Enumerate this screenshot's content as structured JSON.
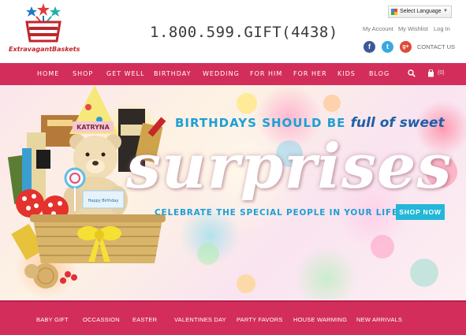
{
  "header": {
    "logo_text": "ExtravagantBaskets",
    "phone": "1.800.599.GIFT(4438)",
    "language_label": "Select Language",
    "links": {
      "account": "My Account",
      "wishlist": "My Wishlist",
      "login": "Log In"
    },
    "social": {
      "facebook": "f",
      "twitter": "t",
      "googleplus": "g+"
    },
    "contact_label": "CONTACT US"
  },
  "nav": {
    "items": [
      "HOME",
      "SHOP",
      "GET WELL",
      "BIRTHDAY",
      "WEDDING",
      "FOR HIM",
      "FOR HER",
      "KIDS",
      "BLOG"
    ],
    "cart_count": "(0)"
  },
  "hero": {
    "headline_prefix": "BIRTHDAYS SHOULD BE ",
    "headline_emphasis": "full of sweet",
    "big_word": "surprises",
    "subline": "CELEBRATE THE SPECIAL PEOPLE IN YOUR LIFE!",
    "cta_label": "SHOP NOW",
    "basket_tag_name": "KATRYNA",
    "basket_card_text": "Happy Birthday"
  },
  "subnav": {
    "items": [
      "BABY GIFT",
      "OCCASSION",
      "EASTER",
      "VALENTINES DAY",
      "PARTY FAVORS",
      "HOUSE WARMING",
      "NEW ARRIVALS"
    ]
  },
  "colors": {
    "brand_pink": "#d32d5b",
    "accent_blue": "#1e9fd3",
    "cta_blue": "#23b7d8",
    "logo_red": "#c0262d"
  },
  "icons": [
    "logo-basket-icon",
    "google-g-icon",
    "facebook-icon",
    "twitter-icon",
    "googleplus-icon",
    "search-icon",
    "cart-icon",
    "chevron-down-icon"
  ]
}
